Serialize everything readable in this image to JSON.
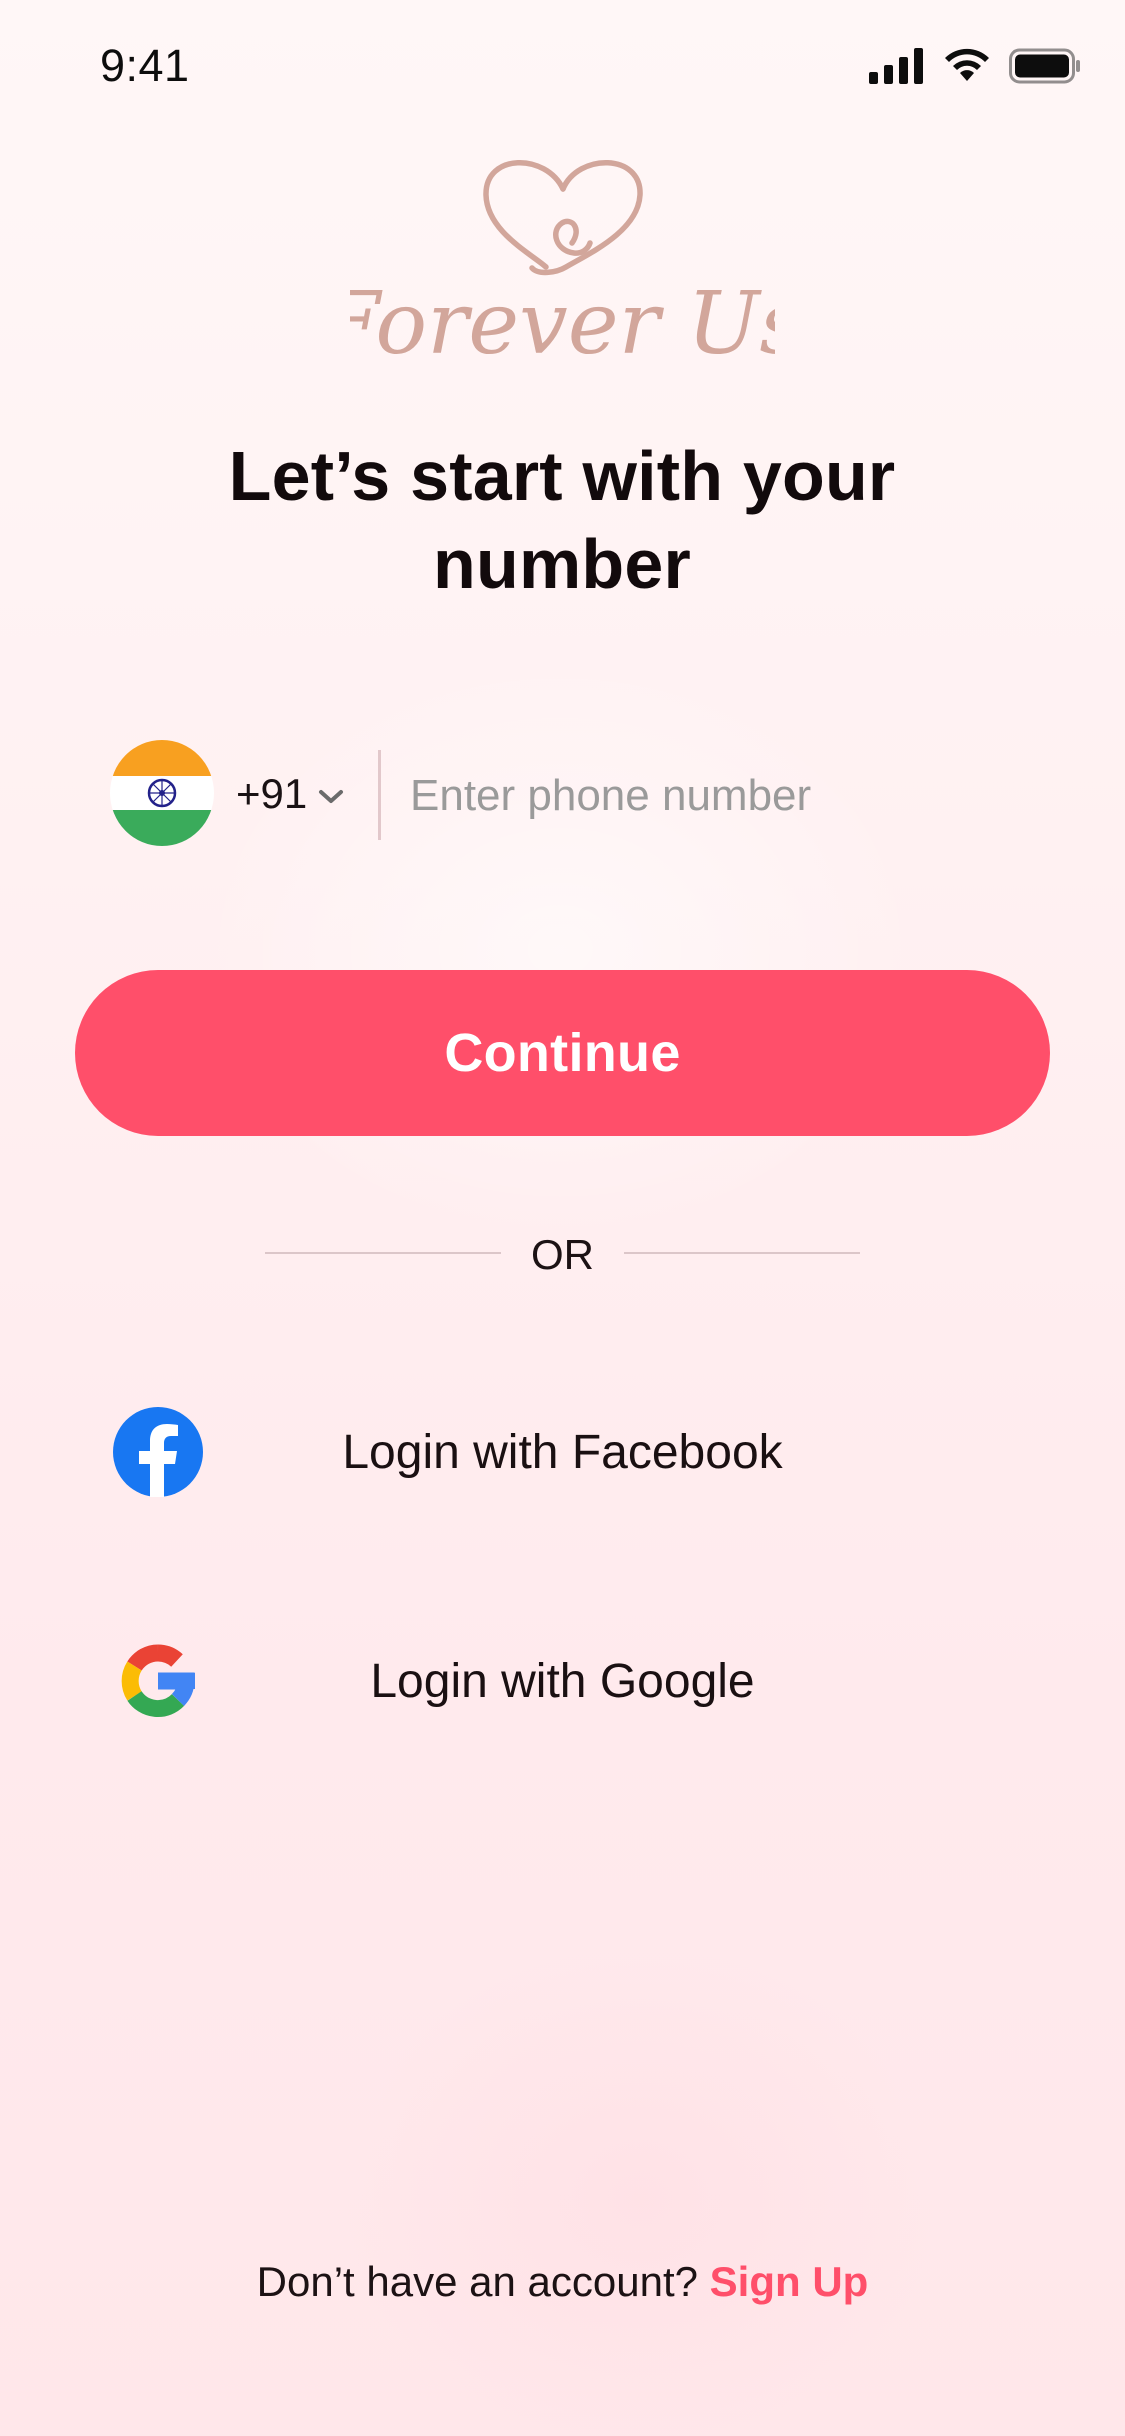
{
  "status_bar": {
    "time": "9:41"
  },
  "brand": {
    "name": "Forever Us",
    "logo_color": "#d2a69b"
  },
  "headline": "Let’s start with your number",
  "phone": {
    "country_flag": "india-flag-icon",
    "country_code": "+91",
    "placeholder": "Enter phone number",
    "value": ""
  },
  "continue_label": "Continue",
  "divider_text": "OR",
  "social": {
    "facebook_label": "Login with Facebook",
    "google_label": "Login with Google"
  },
  "footer": {
    "prompt": "Don’t have an account?",
    "signup_label": "Sign Up"
  },
  "colors": {
    "accent": "#ff4f6a",
    "facebook": "#1877f2",
    "background_top": "#fff7f7",
    "background_bottom": "#ffe7ea"
  }
}
